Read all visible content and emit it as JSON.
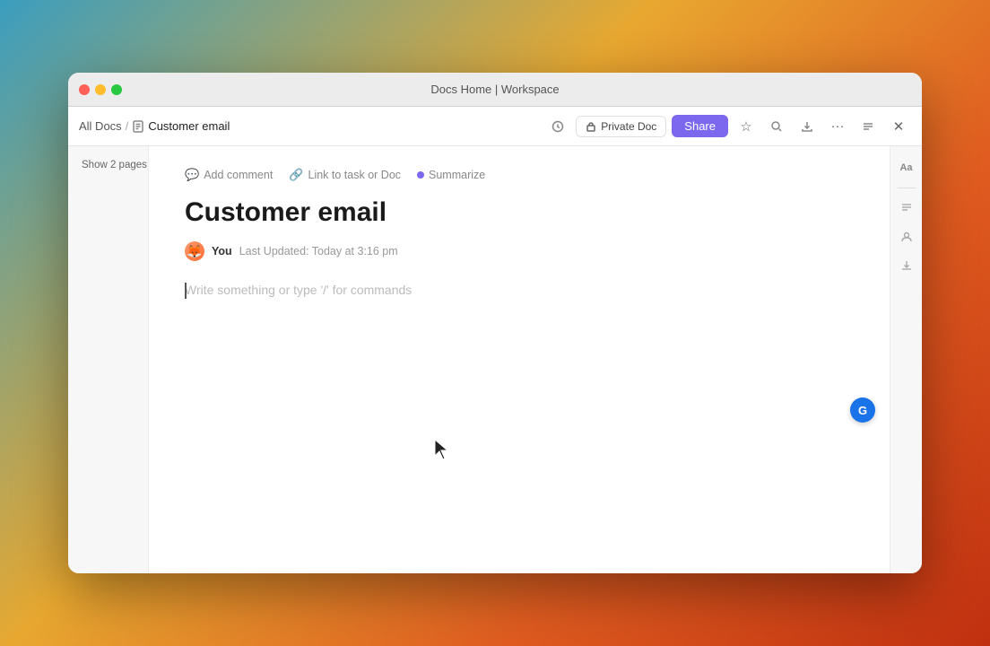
{
  "window": {
    "title": "Docs Home | Workspace",
    "traffic_lights": {
      "close": "close",
      "minimize": "minimize",
      "maximize": "maximize"
    }
  },
  "toolbar": {
    "breadcrumb": {
      "parent": "All Docs",
      "separator": "/",
      "current": "Customer email"
    },
    "private_doc_label": "Private Doc",
    "share_label": "Share"
  },
  "sidebar": {
    "show_pages_label": "Show 2 pages"
  },
  "action_bar": {
    "add_comment": "Add comment",
    "link_to_task": "Link to task or Doc",
    "summarize": "Summarize"
  },
  "document": {
    "title": "Customer email",
    "author": "You",
    "last_updated_prefix": "Last Updated:",
    "last_updated_time": "Today at 3:16 pm",
    "placeholder": "Write something or type '/' for commands"
  },
  "right_sidebar": {
    "icons": [
      {
        "name": "font-size-icon",
        "symbol": "Aa"
      },
      {
        "name": "star-icon",
        "symbol": "☆"
      },
      {
        "name": "person-icon",
        "symbol": "👤"
      },
      {
        "name": "download-icon",
        "symbol": "↓"
      }
    ]
  },
  "floating": {
    "g_button_label": "G"
  }
}
